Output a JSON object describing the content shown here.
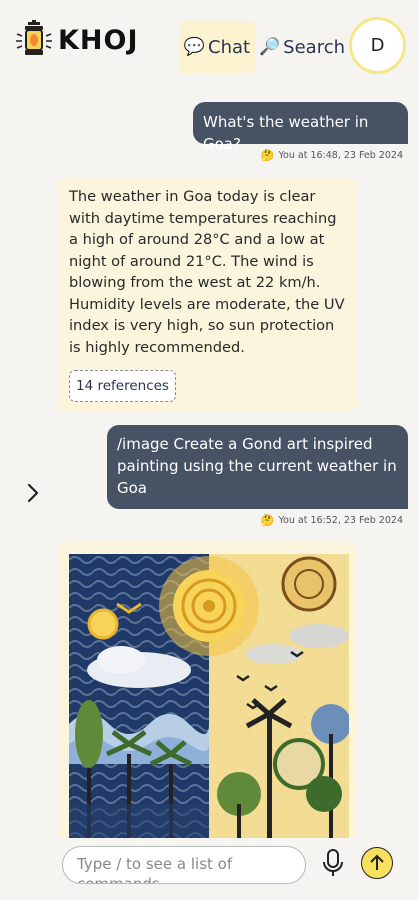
{
  "header": {
    "logo_text": "KHOJ",
    "nav": {
      "chat_label": "Chat",
      "chat_icon": "speech-bubble-icon",
      "search_label": "Search",
      "search_icon": "magnifier-icon"
    },
    "avatar_initial": "D"
  },
  "messages": [
    {
      "role": "user",
      "text": "What's the weather in Goa?",
      "meta": "You at 16:48, 23 Feb 2024",
      "meta_emoji": "🤔"
    },
    {
      "role": "assistant",
      "text": "The weather in Goa today is clear with daytime temperatures reaching a high of around 28°C and a low at night of around 21°C. The wind is blowing from the west at 22 km/h. Humidity levels are moderate, the UV index is very high, so sun protection is highly recommended.",
      "references_label": "14 references"
    },
    {
      "role": "user",
      "text": "/image Create a Gond art inspired painting using the current weather in Goa",
      "meta": "You at 16:52, 23 Feb 2024",
      "meta_emoji": "🤔"
    },
    {
      "role": "assistant",
      "image": "gond-art-weather-painting"
    }
  ],
  "sidebar_toggle_icon": "chevron-right-icon",
  "composer": {
    "placeholder": "Type / to see a list of commands",
    "mic_icon": "microphone-icon",
    "send_icon": "arrow-up-icon"
  },
  "colors": {
    "user_bubble": "#475264",
    "bot_bubble": "#fbf5dd",
    "accent": "#f6e05e",
    "background": "#f5f4f1"
  }
}
